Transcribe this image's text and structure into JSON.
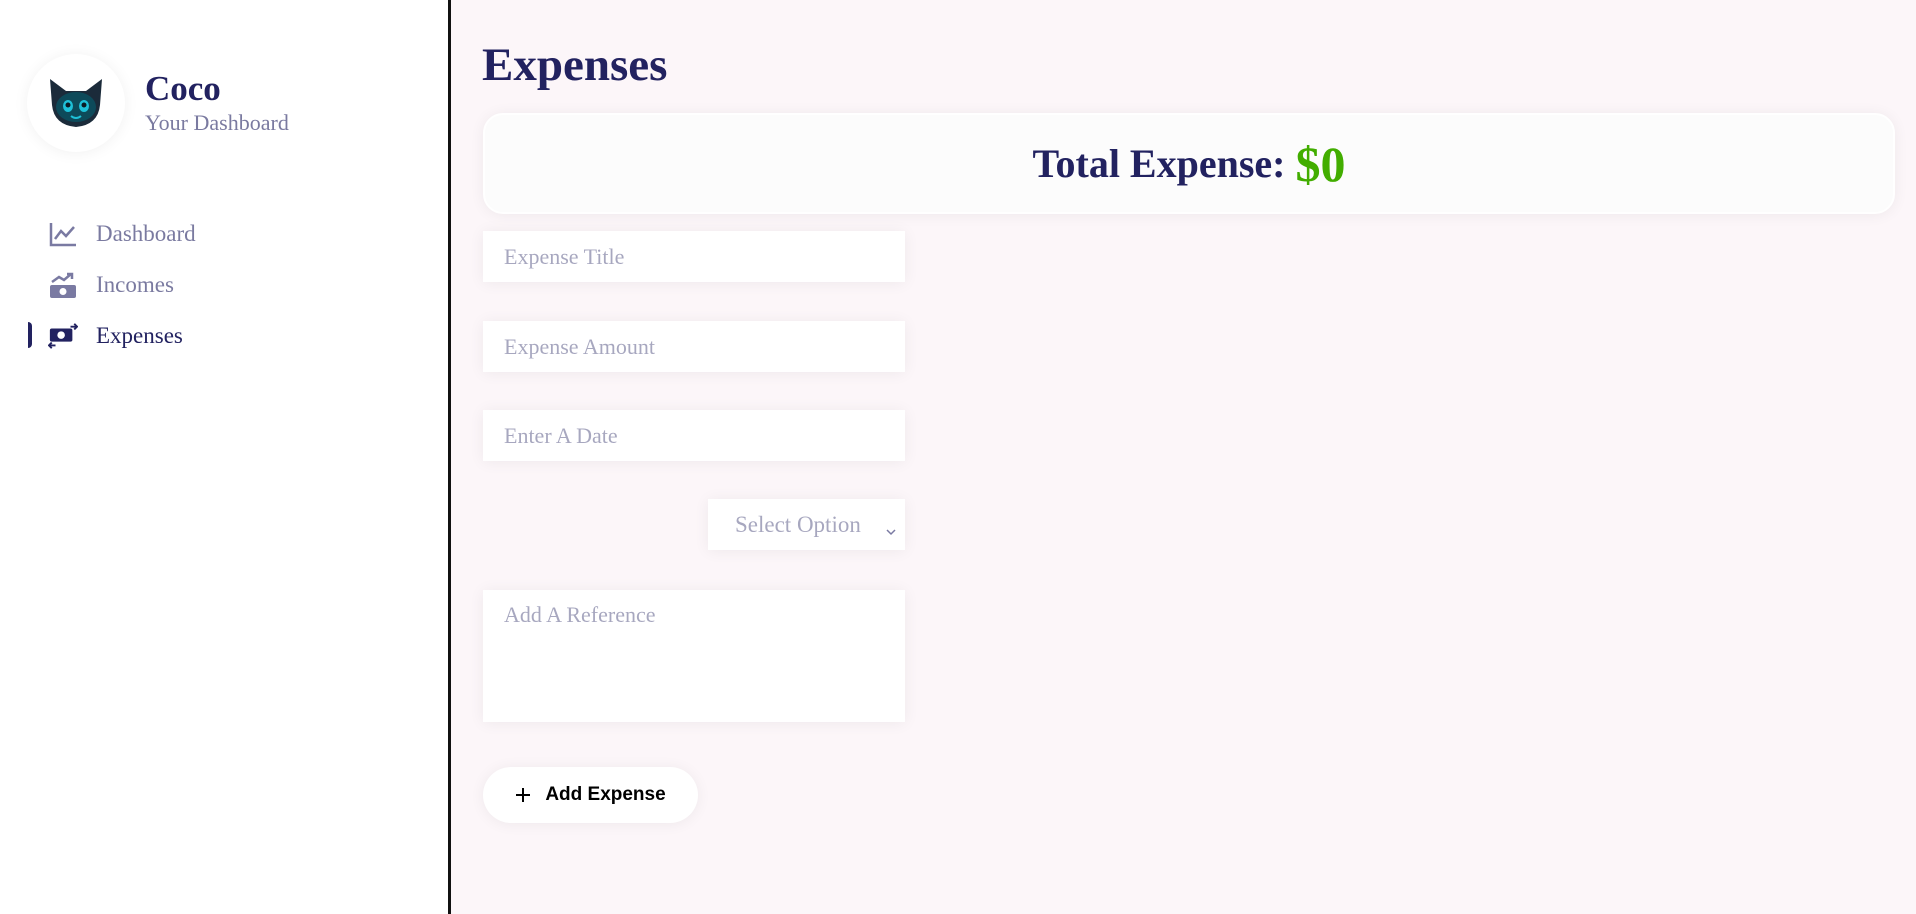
{
  "user": {
    "name": "Coco",
    "subtitle": "Your Dashboard",
    "avatar_icon": "cat-avatar-icon"
  },
  "nav": {
    "items": [
      {
        "label": "Dashboard",
        "icon": "line-chart-icon",
        "active": false
      },
      {
        "label": "Incomes",
        "icon": "money-up-icon",
        "active": false
      },
      {
        "label": "Expenses",
        "icon": "money-exchange-icon",
        "active": true
      }
    ]
  },
  "page": {
    "title": "Expenses"
  },
  "total": {
    "label": "Total Expense:",
    "value": "$0"
  },
  "form": {
    "title_placeholder": "Expense Title",
    "amount_placeholder": "Expense Amount",
    "date_placeholder": "Enter A Date",
    "select_label": "Select Option",
    "reference_placeholder": "Add A Reference",
    "submit_label": "Add Expense"
  },
  "colors": {
    "primary": "#222260",
    "accent_green": "#42ad00",
    "background": "#fcf6f9"
  }
}
